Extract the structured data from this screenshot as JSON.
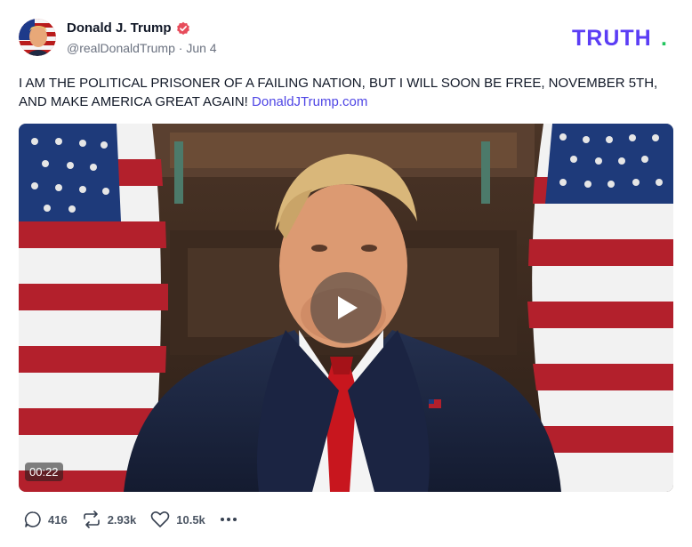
{
  "post": {
    "author": {
      "display_name": "Donald J. Trump",
      "handle": "@realDonaldTrump",
      "separator": " · ",
      "date": "Jun 4",
      "verified_icon": "verified-badge-icon"
    },
    "brand": {
      "logo_text": "TRUTH",
      "logo_dot": "."
    },
    "text": "I AM THE POLITICAL PRISONER OF A FAILING NATION, BUT I WILL SOON BE FREE, NOVEMBER 5TH, AND MAKE AMERICA GREAT AGAIN!",
    "link": "DonaldJTrump.com",
    "video": {
      "duration": "00:22",
      "play_icon": "play-icon"
    },
    "actions": {
      "replies": "416",
      "retruths": "2.93k",
      "likes": "10.5k",
      "more_icon": "more-dots-icon"
    }
  },
  "colors": {
    "brand": "#5b3df5",
    "verified": "#e74c5b",
    "link": "#4f46e5",
    "text": "#111827",
    "muted": "#6b7280"
  }
}
